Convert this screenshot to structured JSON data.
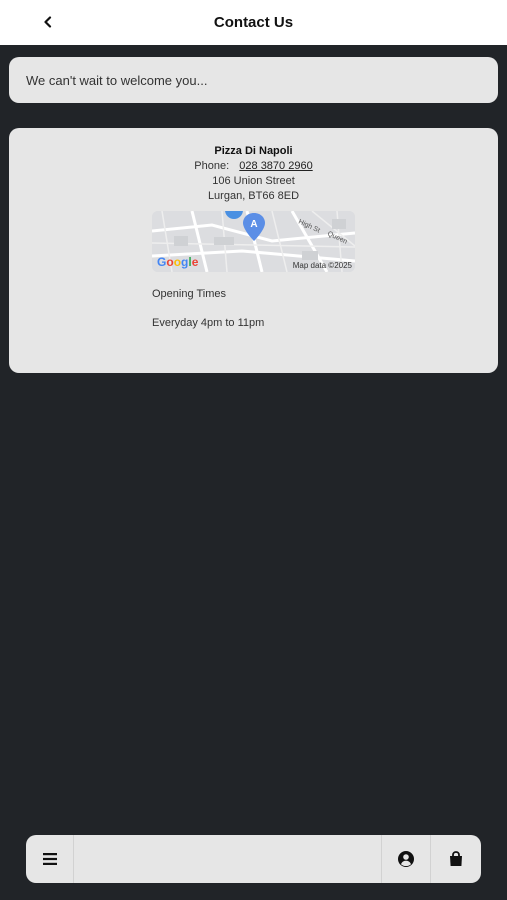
{
  "header": {
    "title": "Contact Us",
    "back_icon": "chevron-left-icon"
  },
  "welcome": {
    "message": "We can't wait to welcome you..."
  },
  "contact": {
    "business_name": "Pizza Di Napoli",
    "phone_label": "Phone:",
    "phone_number": "028 3870 2960",
    "address_line1": "106 Union Street",
    "address_line2": "Lurgan, BT66 8ED"
  },
  "map": {
    "marker_label": "A",
    "attribution": "Map data ©2025",
    "brand": [
      "G",
      "o",
      "o",
      "g",
      "l",
      "e"
    ],
    "street_label": "High St",
    "street_label2": "Queen"
  },
  "hours": {
    "label": "Opening Times",
    "value": "Everyday 4pm to 11pm"
  },
  "bottom_bar": {
    "icons": [
      "menu-icon",
      "account-icon",
      "shopping-bag-icon"
    ]
  },
  "colors": {
    "background": "#212428",
    "card": "#e6e6e6",
    "header": "#ffffff",
    "marker": "#5b8ee6"
  }
}
